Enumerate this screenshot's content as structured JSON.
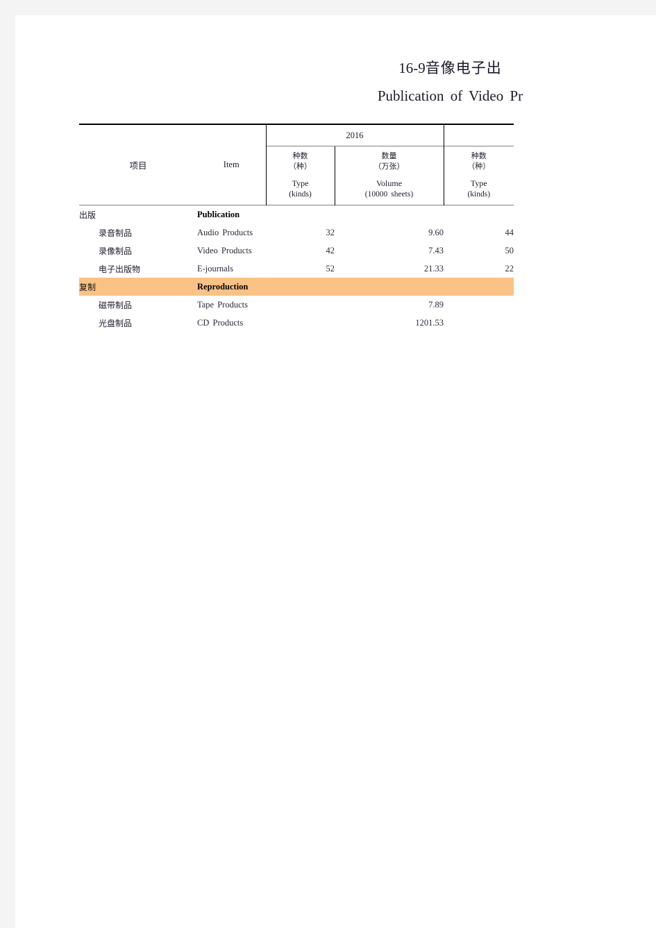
{
  "document": {
    "title_cn_number": "16-9",
    "title_cn_text": "音像电子出",
    "title_en": "Publication  of  Video  Pr"
  },
  "table": {
    "header": {
      "year_label": "2016",
      "year_blank": "",
      "item_cn": "项目",
      "item_en": "Item",
      "columns": [
        {
          "cn": "种数",
          "cn_unit": "（种）",
          "en": "Type",
          "en_unit": "(kinds)"
        },
        {
          "cn": "数量",
          "cn_unit": "（万张）",
          "en": "Volume",
          "en_unit": "(10000  sheets)"
        },
        {
          "cn": "种数",
          "cn_unit": "（种）",
          "en": "Type",
          "en_unit": "(kinds)"
        }
      ]
    },
    "rows": [
      {
        "cn": "出版",
        "en": "Publication",
        "type": "group",
        "highlight": false,
        "type_kinds": "",
        "volume": "",
        "type_kinds_2": ""
      },
      {
        "cn": "录音制品",
        "en": "Audio  Products",
        "type": "data",
        "highlight": false,
        "type_kinds": "32",
        "volume": "9.60",
        "type_kinds_2": "44"
      },
      {
        "cn": "录像制品",
        "en": "Video  Products",
        "type": "data",
        "highlight": false,
        "type_kinds": "42",
        "volume": "7.43",
        "type_kinds_2": "50"
      },
      {
        "cn": "电子出版物",
        "en": "E-journals",
        "type": "data",
        "highlight": false,
        "type_kinds": "52",
        "volume": "21.33",
        "type_kinds_2": "22"
      },
      {
        "cn": "复制",
        "en": "Reproduction",
        "type": "group",
        "highlight": true,
        "type_kinds": "",
        "volume": "",
        "type_kinds_2": ""
      },
      {
        "cn": "磁带制品",
        "en": "Tape  Products",
        "type": "data",
        "highlight": false,
        "type_kinds": "",
        "volume": "7.89",
        "type_kinds_2": ""
      },
      {
        "cn": "光盘制品",
        "en": "CD  Products",
        "type": "data",
        "highlight": false,
        "type_kinds": "",
        "volume": "1201.53",
        "type_kinds_2": ""
      }
    ]
  },
  "colors": {
    "page_background": "#ffffff",
    "gutter": "#f4f4f4",
    "highlight": "#fbc286",
    "rule_heavy": "#000000",
    "rule_light": "#808080",
    "text": "#1b1b2b"
  }
}
